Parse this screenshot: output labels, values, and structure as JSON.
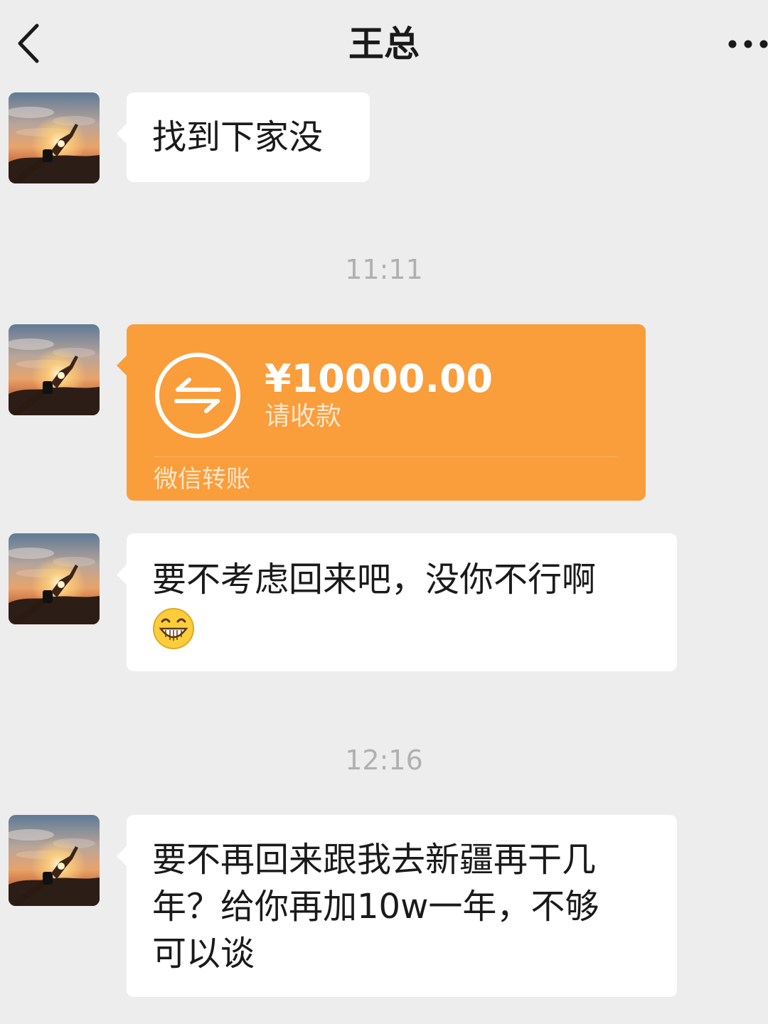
{
  "header": {
    "title": "王总",
    "back_icon": "chevron-left-icon",
    "more_icon": "more-dots-icon"
  },
  "messages": [
    {
      "type": "text",
      "text": "找到下家没"
    },
    {
      "type": "timestamp",
      "text": "11:11"
    },
    {
      "type": "transfer",
      "amount": "¥10000.00",
      "status": "请收款",
      "footer": "微信转账",
      "icon": "transfer-arrows-icon",
      "color": "#fa9d3b"
    },
    {
      "type": "text",
      "text": "要不考虑回来吧，没你不行啊",
      "emoji": "grin-emoji"
    },
    {
      "type": "timestamp",
      "text": "12:16"
    },
    {
      "type": "text",
      "lines": [
        "要不再回来跟我去新疆再干几",
        "年？给你再加10w一年，不够",
        "可以谈"
      ]
    }
  ],
  "colors": {
    "background": "#ededed",
    "bubble": "#ffffff",
    "transfer": "#fa9d3b",
    "timestamp": "#b0b0b0"
  }
}
